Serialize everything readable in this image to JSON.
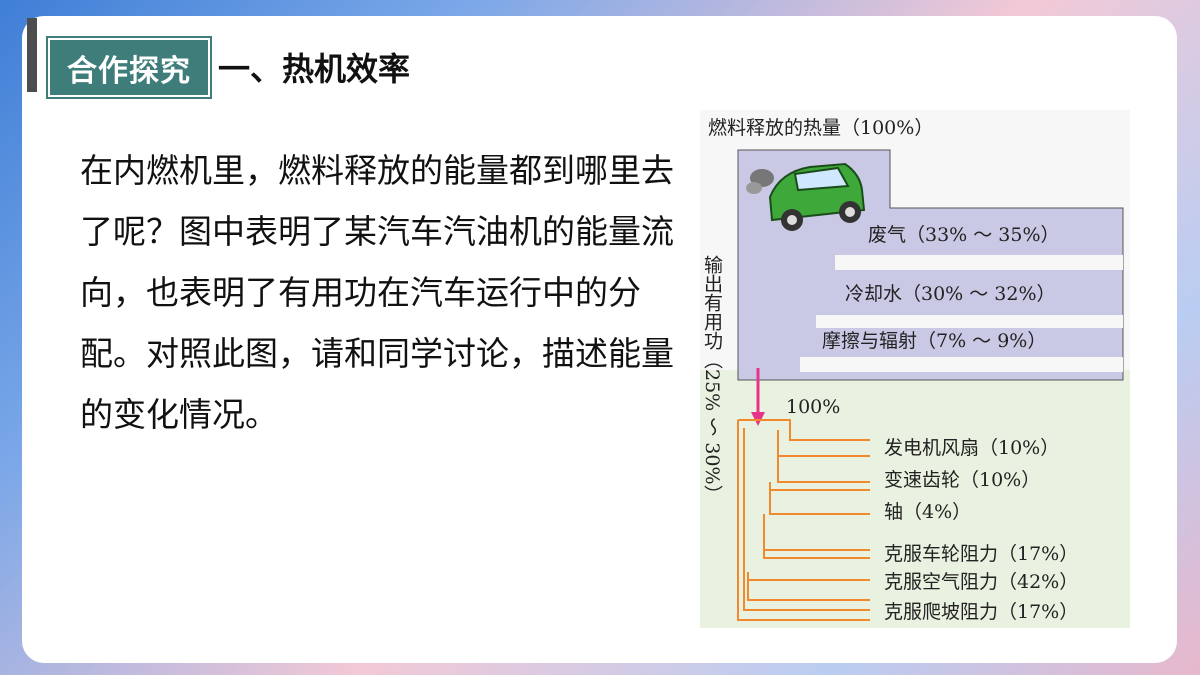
{
  "header": {
    "tag": "合作探究",
    "title": "一、热机效率"
  },
  "paragraph": "在内燃机里，燃料释放的能量都到哪里去了呢？图中表明了某汽车汽油机的能量流向，也表明了有用功在汽车运行中的分配。对照此图，请和同学讨论，描述能量的变化情况。",
  "diagram": {
    "top_label": "燃料释放的热量（100%）",
    "losses": [
      {
        "label": "废气（33% ～ 35%）"
      },
      {
        "label": "冷却水（30% ～ 32%）"
      },
      {
        "label": "摩擦与辐射（7% ～ 9%）"
      }
    ],
    "side_label": "输出有用功（25% ～ 30%）",
    "useful_label": "100%",
    "uses": [
      {
        "label": "发电机风扇（10%）"
      },
      {
        "label": "变速齿轮（10%）"
      },
      {
        "label": "轴（4%）"
      },
      {
        "label": "克服车轮阻力（17%）"
      },
      {
        "label": "克服空气阻力（42%）"
      },
      {
        "label": "克服爬坡阻力（17%）"
      }
    ],
    "colors": {
      "heat_flow": "#c9c9e6",
      "heat_border": "#555555",
      "useful_flow": "#f08a2c",
      "arrow": "#e8338a",
      "background": "#e9f2e0"
    }
  }
}
